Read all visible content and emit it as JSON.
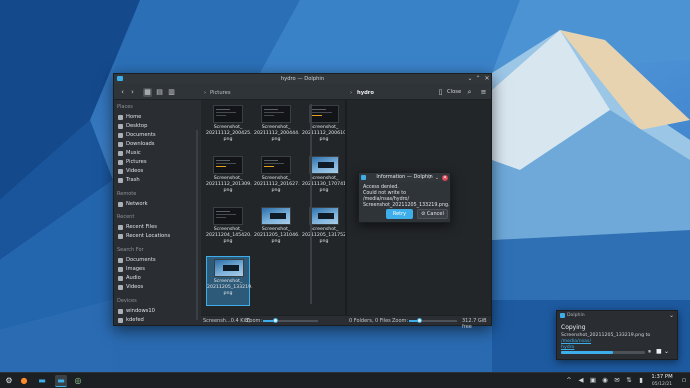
{
  "window": {
    "title": "hydro — Dolphin",
    "close_split_label": "Close"
  },
  "breadcrumbs": {
    "left": "Pictures",
    "right": "hydro"
  },
  "sidebar": {
    "places_header": "Places",
    "places": [
      "Home",
      "Desktop",
      "Documents",
      "Downloads",
      "Music",
      "Pictures",
      "Videos",
      "Trash"
    ],
    "remote_header": "Remote",
    "remote": [
      "Network"
    ],
    "recent_header": "Recent",
    "recent": [
      "Recent Files",
      "Recent Locations"
    ],
    "search_header": "Search For",
    "search": [
      "Documents",
      "Images",
      "Audio",
      "Videos"
    ],
    "devices_header": "Devices",
    "devices": [
      "windows10",
      "kdefed"
    ]
  },
  "files": [
    {
      "line1": "Screenshot_",
      "line2": "20211112_200425.",
      "line3": "png"
    },
    {
      "line1": "Screenshot_",
      "line2": "20211112_200444.",
      "line3": "png"
    },
    {
      "line1": "Screenshot_",
      "line2": "20211112_200610.",
      "line3": "png"
    },
    {
      "line1": "Screenshot_",
      "line2": "20211112_201309.",
      "line3": "png"
    },
    {
      "line1": "Screenshot_",
      "line2": "20211112_201627.",
      "line3": "png"
    },
    {
      "line1": "Screenshot_",
      "line2": "20211130_170741.",
      "line3": "png"
    },
    {
      "line1": "Screenshot_",
      "line2": "20211204_145420.",
      "line3": "png"
    },
    {
      "line1": "Screenshot_",
      "line2": "20211205_131046.",
      "line3": "png"
    },
    {
      "line1": "Screenshot_",
      "line2": "20211205_131752.",
      "line3": "png"
    },
    {
      "line1": "Screenshot_",
      "line2": "20211205_133219.",
      "line3": "png"
    }
  ],
  "status_left": {
    "selection": "Screensh...0.4 KiB)",
    "zoom_label": "Zoom:",
    "zoom_level": 0.22
  },
  "status_right": {
    "summary": "0 Folders, 0 Files",
    "zoom_label": "Zoom:",
    "free": "312.7 GiB free",
    "zoom_level": 0.22
  },
  "dialog": {
    "title": "Information — Dolphin",
    "line1": "Access denied.",
    "line2": "Could not write to /media/nsas/hydro/",
    "line3": "Screenshot_20211205_133219.png.",
    "retry": "Retry",
    "cancel": "Cancel"
  },
  "notification": {
    "app": "Dolphin",
    "title": "Copying",
    "body": "Screenshot_20211205_133219.png to",
    "link1": "/media/nsas/",
    "link2": "hydro",
    "progress": 0.62
  },
  "clock": {
    "time": "1:37 PM",
    "date": "05/12/21"
  },
  "colors": {
    "accent": "#3daee9",
    "window_bg": "#2a2e32",
    "close_red": "#da4453"
  }
}
